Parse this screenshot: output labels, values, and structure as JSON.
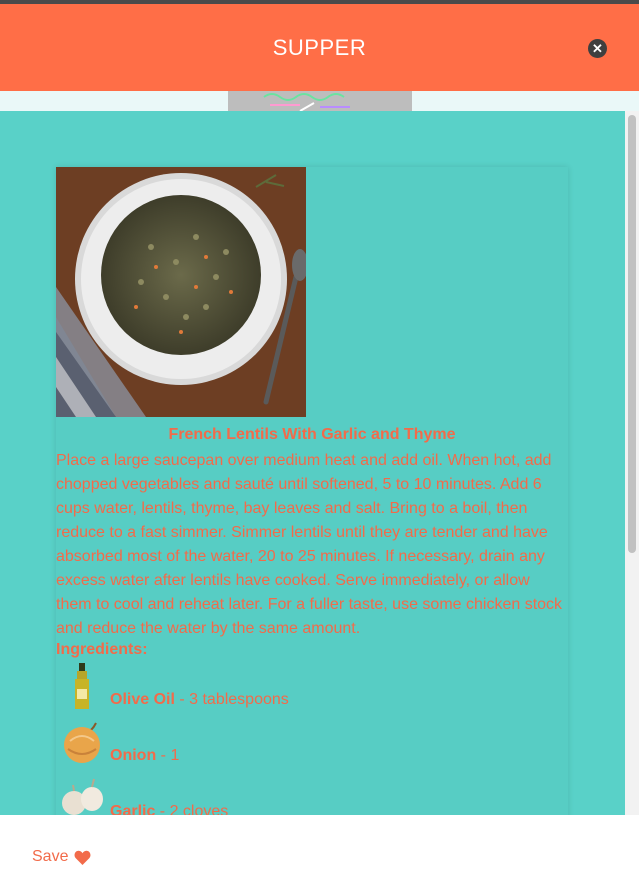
{
  "header": {
    "title": "SUPPER",
    "close_icon": "close-icon"
  },
  "recipe": {
    "title": "French Lentils With Garlic and Thyme",
    "instructions": "Place a large saucepan over medium heat and add oil. When hot, add chopped vegetables and sauté until softened, 5 to 10 minutes. Add 6 cups water, lentils, thyme, bay leaves and salt. Bring to a boil, then reduce to a fast simmer. Simmer lentils until they are tender and have absorbed most of the water, 20 to 25 minutes. If necessary, drain any excess water after lentils have cooked. Serve immediately, or allow them to cool and reheat later. For a fuller taste, use some chicken stock and reduce the water by the same amount.",
    "ingredients_label": "Ingredients:",
    "ingredients": [
      {
        "name": "Olive Oil",
        "amount": " - 3 tablespoons",
        "icon": "olive-oil-icon"
      },
      {
        "name": "Onion",
        "amount": " - 1",
        "icon": "onion-icon"
      },
      {
        "name": "Garlic",
        "amount": " - 2 cloves",
        "icon": "garlic-icon"
      }
    ]
  },
  "footer": {
    "save_label": "Save",
    "save_icon": "heart-icon"
  },
  "colors": {
    "header_bg": "#ff6e47",
    "modal_bg": "#59d1c8",
    "text_accent": "#f26b4a"
  }
}
